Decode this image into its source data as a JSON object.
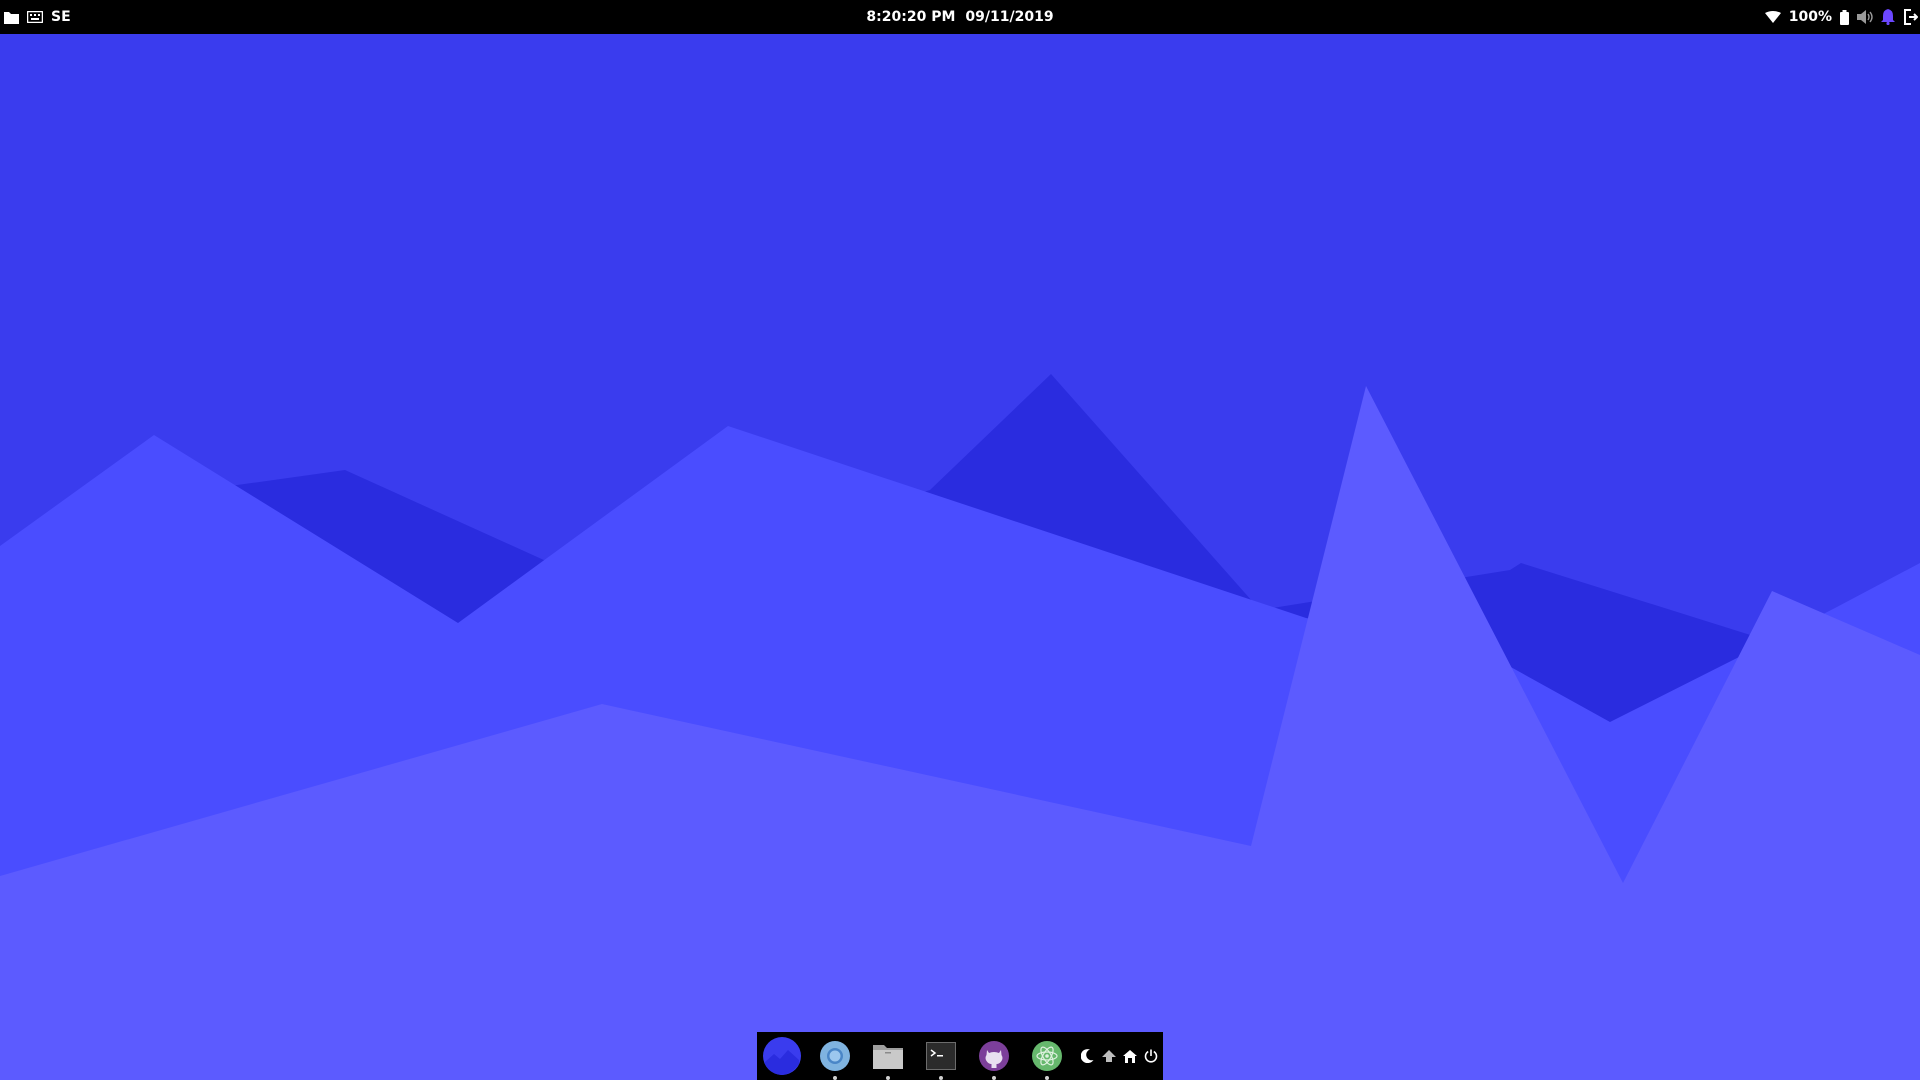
{
  "wallpaper": {
    "colors": {
      "sky": "#3a3cee",
      "far": "#2a2cdf",
      "mid": "#4a4dff",
      "near": "#5c5bff"
    }
  },
  "top_panel": {
    "left": {
      "files_icon": "folder-icon",
      "keyboard_icon": "keyboard-icon",
      "keyboard_layout": "SE"
    },
    "center": {
      "time": "8:20:20 PM",
      "date": "09/11/2019"
    },
    "right": {
      "wifi_icon": "wifi-icon",
      "battery_percent": "100%",
      "battery_icon": "battery-icon",
      "volume_icon": "volume-icon",
      "notification_icon": "bell-icon",
      "logout_icon": "logout-icon"
    }
  },
  "dock": {
    "apps": [
      {
        "name": "launcher",
        "icon": "launcher-icon",
        "running": false
      },
      {
        "name": "chromium",
        "icon": "chromium-icon",
        "running": true
      },
      {
        "name": "files",
        "icon": "file-manager-icon",
        "running": true
      },
      {
        "name": "terminal",
        "icon": "terminal-icon",
        "running": true
      },
      {
        "name": "github-desktop",
        "icon": "github-icon",
        "running": true
      },
      {
        "name": "atom",
        "icon": "atom-icon",
        "running": true
      }
    ],
    "actions": [
      {
        "name": "suspend",
        "icon": "moon-icon"
      },
      {
        "name": "hibernate",
        "icon": "upload-icon"
      },
      {
        "name": "home",
        "icon": "home-icon"
      },
      {
        "name": "power",
        "icon": "power-icon"
      }
    ],
    "colors": {
      "launcher": "#3a3cee",
      "chromium": "#7fb3e0",
      "files": "#c9c9c9",
      "terminal": "#2b2b2b",
      "github": "#7c3f9a",
      "atom": "#66b86d"
    }
  }
}
